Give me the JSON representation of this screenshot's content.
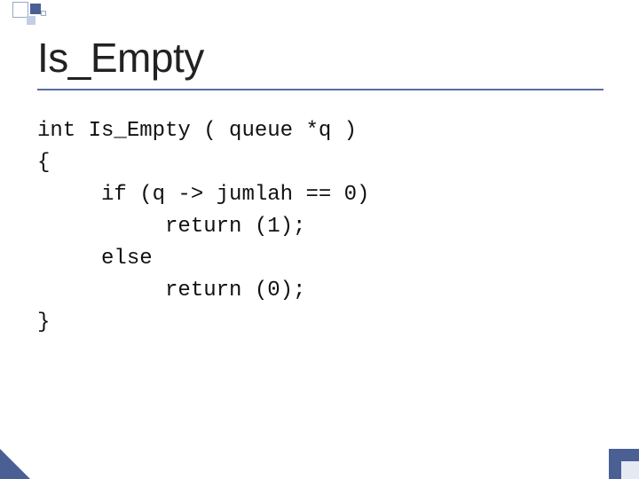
{
  "slide": {
    "title": "Is_Empty",
    "code": {
      "l1": "int Is_Empty ( queue *q )",
      "l2": "{",
      "l3": "     if (q -> jumlah == 0)",
      "l4": "          return (1);",
      "l5": "     else",
      "l6": "          return (0);",
      "l7": "}"
    }
  }
}
